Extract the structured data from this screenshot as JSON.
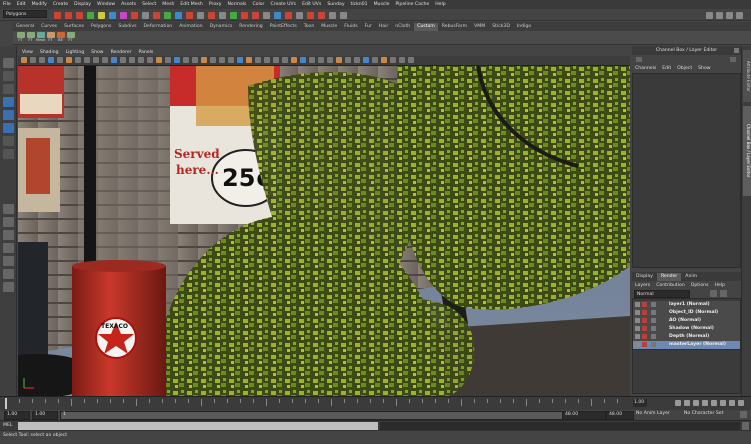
{
  "menubar": [
    "File",
    "Edit",
    "Modify",
    "Create",
    "Display",
    "Window",
    "Assets",
    "Select",
    "Mesh",
    "Edit Mesh",
    "Proxy",
    "Normals",
    "Color",
    "Create UVs",
    "Edit UVs",
    "Sunday",
    "tickn01",
    "Muscle",
    "Pipeline Cache",
    "Help"
  ],
  "mode": "Polygons",
  "shelf_tabs": [
    "General",
    "Curves",
    "Surfaces",
    "Polygons",
    "Subdivs",
    "Deformation",
    "Animation",
    "Dynamics",
    "Rendering",
    "PaintEffects",
    "Toon",
    "Muscle",
    "Fluids",
    "Fur",
    "Hair",
    "nCloth",
    "Custom",
    "RebusFarm",
    "VMM",
    "Stick3D",
    "Indigo"
  ],
  "shelf_active": "Custom",
  "shelf_items": [
    "FT",
    "FT",
    "Mesh",
    "FT",
    "BE",
    "FT"
  ],
  "viewport_menu": [
    "View",
    "Shading",
    "Lighting",
    "Show",
    "Renderer",
    "Panels"
  ],
  "channel_box": {
    "title": "Channel Box / Layer Editor",
    "menu": [
      "Channels",
      "Edit",
      "Object",
      "Show"
    ]
  },
  "side_tabs": [
    "Attribute Editor",
    "Channel Box / Layer Editor"
  ],
  "layer_editor": {
    "tabs": [
      "Display",
      "Render",
      "Anim"
    ],
    "active_tab": "Render",
    "menu": [
      "Layers",
      "Contribution",
      "Options",
      "Help"
    ],
    "blend_mode": "Normal",
    "layers": [
      {
        "name": "layer1 (Normal)",
        "selected": false
      },
      {
        "name": "Object_ID (Normal)",
        "selected": false
      },
      {
        "name": "AO (Normal)",
        "selected": false
      },
      {
        "name": "Shadow (Normal)",
        "selected": false
      },
      {
        "name": "Depth (Normal)",
        "selected": false
      },
      {
        "name": "masterLayer (Normal)",
        "selected": true
      }
    ]
  },
  "poster": {
    "line1": "Served",
    "line2": "here...",
    "price": "25¢"
  },
  "barrel_logo": "TEXACO",
  "timeline": {
    "start": "1.00",
    "range_start": "1.00",
    "current": "1",
    "range_end": "48.00",
    "end": "48.00",
    "current_frame": "1.00",
    "anim_layer": "No Anim Layer",
    "character_set": "No Character Set"
  },
  "command_line": {
    "label": "MEL"
  },
  "help_line": "Select Tool: select an object",
  "colors": {
    "menu_bg": "#3a3a3a",
    "panel_bg": "#444444",
    "selection": "#6d88b2",
    "sky": "#6d7c93",
    "foliage": "#7f9a22"
  }
}
